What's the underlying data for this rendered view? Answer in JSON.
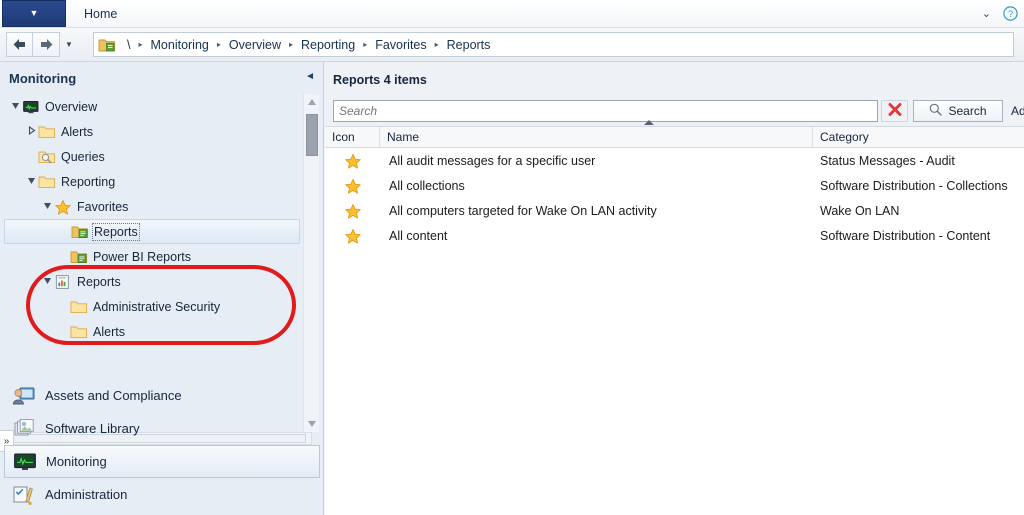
{
  "window": {
    "file_tab_icon": "chevron-down-icon",
    "home_tab": "Home",
    "minimize_ribbon_icon": "chevron-down-icon",
    "help_icon": "help-icon"
  },
  "address_bar": {
    "back_icon": "back-arrow-icon",
    "forward_icon": "forward-arrow-icon",
    "history_icon": "chevron-down-icon",
    "root_icon": "console-folder-icon",
    "crumbs": [
      "\\",
      "Monitoring",
      "Overview",
      "Reporting",
      "Favorites",
      "Reports"
    ],
    "separator": "▸"
  },
  "sidebar": {
    "title": "Monitoring",
    "collapse_icon": "chevron-left-icon",
    "expand_icon": "chevron-right-icon",
    "tree": [
      {
        "label": "Overview",
        "icon": "monitor-icon",
        "indent": 0,
        "expander": "expanded",
        "selected": false
      },
      {
        "label": "Alerts",
        "icon": "folder-icon",
        "indent": 1,
        "expander": "collapsed",
        "selected": false
      },
      {
        "label": "Queries",
        "icon": "query-folder-icon",
        "indent": 1,
        "expander": "none",
        "selected": false
      },
      {
        "label": "Reporting",
        "icon": "folder-icon",
        "indent": 1,
        "expander": "expanded",
        "selected": false
      },
      {
        "label": "Favorites",
        "icon": "star-icon",
        "indent": 2,
        "expander": "expanded",
        "selected": false
      },
      {
        "label": "Reports",
        "icon": "report-folder-icon",
        "indent": 3,
        "expander": "none",
        "selected": true
      },
      {
        "label": "Power BI Reports",
        "icon": "report-folder-icon",
        "indent": 3,
        "expander": "none",
        "selected": false
      },
      {
        "label": "Reports",
        "icon": "report-page-icon",
        "indent": 2,
        "expander": "expanded",
        "selected": false
      },
      {
        "label": "Administrative Security",
        "icon": "folder-icon",
        "indent": 3,
        "expander": "none",
        "selected": false
      },
      {
        "label": "Alerts",
        "icon": "folder-icon",
        "indent": 3,
        "expander": "none",
        "selected": false
      }
    ],
    "workspaces": [
      {
        "label": "Assets and Compliance",
        "icon": "assets-icon",
        "selected": false
      },
      {
        "label": "Software Library",
        "icon": "software-library-icon",
        "selected": false
      },
      {
        "label": "Monitoring",
        "icon": "monitoring-icon",
        "selected": true
      },
      {
        "label": "Administration",
        "icon": "administration-icon",
        "selected": false
      }
    ]
  },
  "content": {
    "header": "Reports 4 items",
    "search": {
      "placeholder": "Search",
      "value": "",
      "clear_icon": "red-x-icon",
      "search_button": "Search",
      "search_icon": "magnifier-icon",
      "add_criteria": "Add"
    },
    "table": {
      "columns": [
        "Icon",
        "Name",
        "Category"
      ],
      "sort_column": "Name",
      "sort_direction": "ascending",
      "rows": [
        {
          "icon": "star-icon",
          "name": "All audit messages for a specific user",
          "category": "Status Messages - Audit"
        },
        {
          "icon": "star-icon",
          "name": "All collections",
          "category": "Software Distribution - Collections"
        },
        {
          "icon": "star-icon",
          "name": "All computers targeted for Wake On LAN activity",
          "category": "Wake On LAN"
        },
        {
          "icon": "star-icon",
          "name": "All content",
          "category": "Software Distribution - Content"
        }
      ]
    }
  },
  "annotation": {
    "shape": "red-ellipse-highlight",
    "color": "#e01b1b"
  }
}
